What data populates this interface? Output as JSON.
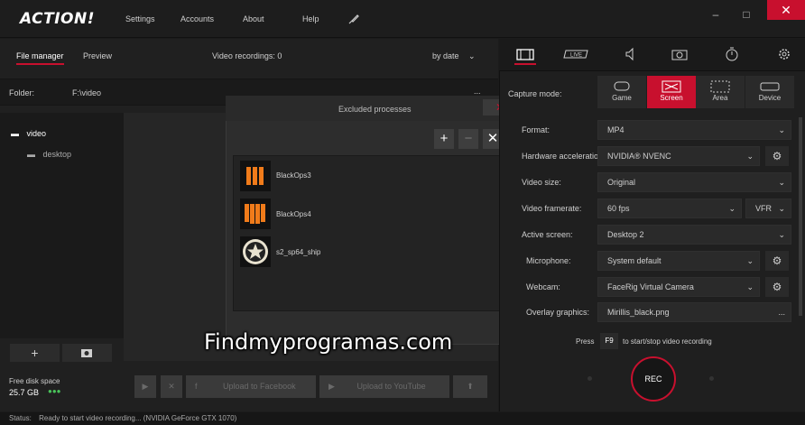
{
  "app": {
    "logo": "ACTION!"
  },
  "menu": [
    "Settings",
    "Accounts",
    "About",
    "Help"
  ],
  "window": {
    "minimize": "–",
    "maximize": "□",
    "close": "✕"
  },
  "left": {
    "tabs": [
      "File manager",
      "Preview"
    ],
    "recordings_label": "Video recordings: 0",
    "sort": "by date",
    "folder_label": "Folder:",
    "folder_path": "F:\\video",
    "tree": [
      "video",
      "desktop"
    ],
    "free_disk_label": "Free disk space",
    "free_disk_value": "25.7 GB",
    "upload_facebook": "Upload to Facebook",
    "upload_youtube": "Upload to YouTube"
  },
  "dialog": {
    "title": "Excluded processes",
    "processes": [
      "BlackOps3",
      "BlackOps4",
      "s2_sp64_ship"
    ]
  },
  "right": {
    "capture_mode_label": "Capture mode:",
    "modes": [
      "Game",
      "Screen",
      "Area",
      "Device"
    ],
    "rows": [
      {
        "label": "Format:",
        "value": "MP4"
      },
      {
        "label": "Hardware acceleration:",
        "value": "NVIDIA® NVENC"
      },
      {
        "label": "Video size:",
        "value": "Original"
      },
      {
        "label": "Video framerate:",
        "value": "60 fps",
        "extra": "VFR"
      },
      {
        "label": "Active screen:",
        "value": "Desktop 2"
      },
      {
        "label": "Microphone:",
        "value": "System default"
      },
      {
        "label": "Webcam:",
        "value": "FaceRig Virtual Camera"
      },
      {
        "label": "Overlay graphics:",
        "value": "Mirillis_black.png"
      }
    ],
    "press_label": "Press",
    "hotkey": "F9",
    "hotkey_hint": "to start/stop video recording",
    "rec_label": "REC"
  },
  "status": {
    "label": "Status:",
    "text": "Ready to start video recording... (NVIDIA GeForce GTX 1070)"
  },
  "watermark": "Findmyprogramas.com",
  "colors": {
    "accent": "#c8102e"
  }
}
